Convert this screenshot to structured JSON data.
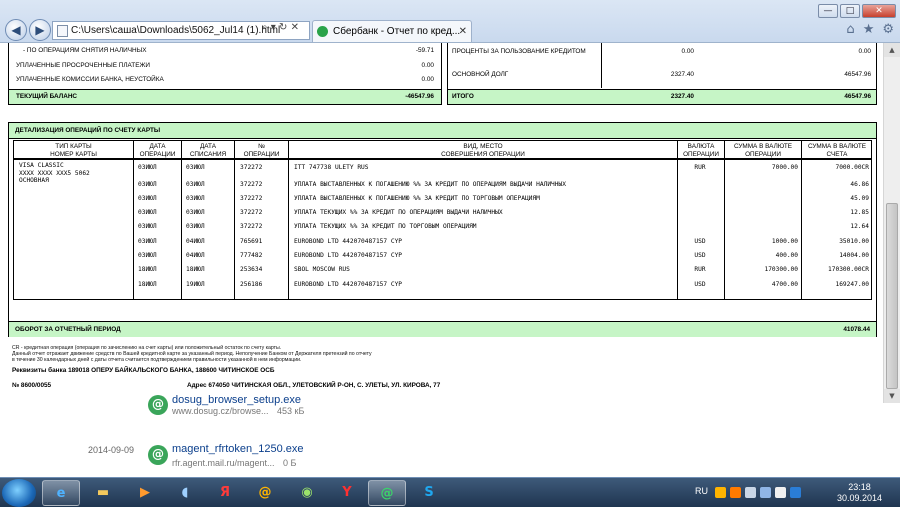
{
  "browser": {
    "address": "C:\\Users\\саша\\Downloads\\5062_Jul14 (1).html",
    "tab_title": "Сбербанк - Отчет по кред...",
    "window_controls": [
      "—",
      "□",
      "✕"
    ]
  },
  "statement": {
    "left_summary": [
      {
        "label": "- ПО ОПЕРАЦИЯМ СНЯТИЯ НАЛИЧНЫХ",
        "value": "-59.71"
      },
      {
        "label": "УПЛАЧЕННЫЕ ПРОСРОЧЕННЫЕ ПЛАТЕЖИ",
        "value": "0.00"
      },
      {
        "label": "УПЛАЧЕННЫЕ КОМИССИИ БАНКА, НЕУСТОЙКА",
        "value": "0.00"
      }
    ],
    "left_total": {
      "label": "ТЕКУЩИЙ БАЛАНС",
      "value": "-46547.96"
    },
    "right_summary": [
      {
        "label": "ПРОЦЕНТЫ ЗА ПОЛЬЗОВАНИЕ КРЕДИТОМ",
        "value1": "0.00",
        "value2": "0.00"
      },
      {
        "label": "ОСНОВНОЙ ДОЛГ",
        "value1": "2327.40",
        "value2": "46547.96"
      }
    ],
    "right_total": {
      "label": "ИТОГО",
      "value1": "2327.40",
      "value2": "46547.96"
    },
    "ops_title": "ДЕТАЛИЗАЦИЯ ОПЕРАЦИЙ ПО СЧЕТУ КАРТЫ",
    "headers": {
      "card": "ТИП КАРТЫ\nНОМЕР КАРТЫ",
      "op_date": "ДАТА\nОПЕРАЦИИ",
      "post_date": "ДАТА\nСПИСАНИЯ",
      "num": "№\nОПЕРАЦИИ",
      "desc": "ВИД, МЕСТО\nСОВЕРШЕНИЯ ОПЕРАЦИИ",
      "currency": "ВАЛЮТА\nОПЕРАЦИИ",
      "amount_op": "СУММА В ВАЛЮТЕ\nОПЕРАЦИИ",
      "amount_acc": "СУММА В ВАЛЮТЕ\nСЧЕТА"
    },
    "card_info": [
      "VISA CLASSIC",
      "XXXX XXXX XXX5 5062",
      "ОСНОВНАЯ"
    ],
    "operations": [
      {
        "op_date": "03ИЮЛ",
        "post_date": "03ИЮЛ",
        "num": "372272",
        "desc": "ITT 747738 ULETY RUS",
        "currency": "RUR",
        "amount_op": "7000.00",
        "amount_acc": "7000.00CR"
      },
      {
        "op_date": "03ИЮЛ",
        "post_date": "03ИЮЛ",
        "num": "372272",
        "desc": "УПЛАТА ВЫСТАВЛЕННЫХ К ПОГАШЕНИЮ %% ЗА КРЕДИТ ПО ОПЕРАЦИЯМ ВЫДАЧИ НАЛИЧНЫХ",
        "currency": "",
        "amount_op": "",
        "amount_acc": "46.86"
      },
      {
        "op_date": "03ИЮЛ",
        "post_date": "03ИЮЛ",
        "num": "372272",
        "desc": "УПЛАТА ВЫСТАВЛЕННЫХ К ПОГАШЕНИЮ %% ЗА КРЕДИТ ПО ТОРГОВЫМ ОПЕРАЦИЯМ",
        "currency": "",
        "amount_op": "",
        "amount_acc": "45.09"
      },
      {
        "op_date": "03ИЮЛ",
        "post_date": "03ИЮЛ",
        "num": "372272",
        "desc": "УПЛАТА ТЕКУЩИХ %% ЗА КРЕДИТ ПО ОПЕРАЦИЯМ ВЫДАЧИ НАЛИЧНЫХ",
        "currency": "",
        "amount_op": "",
        "amount_acc": "12.85"
      },
      {
        "op_date": "03ИЮЛ",
        "post_date": "03ИЮЛ",
        "num": "372272",
        "desc": "УПЛАТА ТЕКУЩИХ %% ЗА КРЕДИТ ПО ТОРГОВЫМ ОПЕРАЦИЯМ",
        "currency": "",
        "amount_op": "",
        "amount_acc": "12.64"
      },
      {
        "op_date": "03ИЮЛ",
        "post_date": "04ИЮЛ",
        "num": "765691",
        "desc": "EUROBOND LTD 442070487157 CYP",
        "currency": "USD",
        "amount_op": "1000.00",
        "amount_acc": "35010.00"
      },
      {
        "op_date": "03ИЮЛ",
        "post_date": "04ИЮЛ",
        "num": "777482",
        "desc": "EUROBOND LTD 442070487157 CYP",
        "currency": "USD",
        "amount_op": "400.00",
        "amount_acc": "14004.00"
      },
      {
        "op_date": "18ИЮЛ",
        "post_date": "18ИЮЛ",
        "num": "253634",
        "desc": "SBOL MOSCOW RUS",
        "currency": "RUR",
        "amount_op": "170300.00",
        "amount_acc": "170300.00CR"
      },
      {
        "op_date": "18ИЮЛ",
        "post_date": "19ИЮЛ",
        "num": "256186",
        "desc": "EUROBOND LTD 442070487157 CYP",
        "currency": "USD",
        "amount_op": "4700.00",
        "amount_acc": "169247.00"
      }
    ],
    "turnover": {
      "label": "ОБОРОТ ЗА ОТЧЕТНЫЙ ПЕРИОД",
      "value": "41078.44"
    },
    "notes": [
      "CR - кредитная операция (операция по зачислению на счет карты) или положительный остаток по счету карты.",
      "Данный отчет отражает движение средств по Вашей кредитной карте за указанный период. Неполучение Банком от Держателя претензий по отчету",
      "в течение 30 календарных дней с даты отчета считается подтверждением правильности указанной в нем информации."
    ],
    "bank_requisites": "Реквизиты банка 189018 ОПЕРУ БАЙКАЛЬСКОГО БАНКА, 188600 ЧИТИНСКОЕ ОСБ",
    "bank_number": "№ 8600/0055",
    "bank_address": "Адрес 674050 ЧИТИНСКАЯ ОБЛ., УЛЕТОВСКИЙ Р-ОН, С. УЛЕТЫ, УЛ. КИРОВА, 77"
  },
  "downloads": [
    {
      "name": "dosug_browser_setup.exe",
      "source": "www.dosug.cz/browse...",
      "size": "453 кБ"
    },
    {
      "date": "2014-09-09",
      "name": "magent_rfrtoken_1250.exe",
      "source": "rfr.agent.mail.ru/magent...",
      "size": "0 Б"
    }
  ],
  "taskbar": {
    "apps": [
      "ie",
      "explorer",
      "media-player",
      "audio",
      "yandex",
      "mail-agent",
      "android",
      "yandex-browser",
      "mail-agent-active",
      "skype"
    ],
    "lang": "RU",
    "time": "23:18",
    "date": "30.09.2014"
  }
}
